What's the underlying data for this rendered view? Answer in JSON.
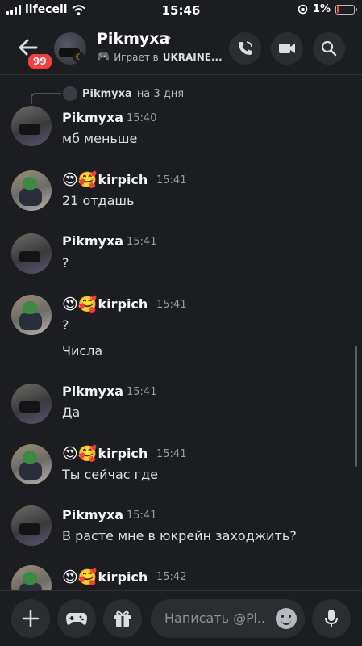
{
  "status_bar": {
    "carrier": "lifecell",
    "time": "15:46",
    "battery": "1%"
  },
  "header": {
    "name": "Pikmyxa",
    "chevron": "›",
    "unread_badge": "99",
    "activity_prefix": "Играет в",
    "activity_game": "UKRAINE..."
  },
  "reply": {
    "name": "Pikmyxa",
    "text": "на 3 дня"
  },
  "messages": [
    {
      "author": "Pikmyxa",
      "emoji": "",
      "time": "15:40",
      "lines": [
        "мб меньше"
      ]
    },
    {
      "author": "kirpich",
      "emoji": "😍🥰",
      "time": "15:41",
      "lines": [
        "21 отдашь"
      ]
    },
    {
      "author": "Pikmyxa",
      "emoji": "",
      "time": "15:41",
      "lines": [
        "?"
      ]
    },
    {
      "author": "kirpich",
      "emoji": "😍🥰",
      "time": "15:41",
      "lines": [
        "?",
        "Числа"
      ]
    },
    {
      "author": "Pikmyxa",
      "emoji": "",
      "time": "15:41",
      "lines": [
        "Да"
      ]
    },
    {
      "author": "kirpich",
      "emoji": "😍🥰",
      "time": "15:41",
      "lines": [
        "Ты сейчас где"
      ]
    },
    {
      "author": "Pikmyxa",
      "emoji": "",
      "time": "15:41",
      "lines": [
        "В расте мне в юкрейн заходжить?"
      ]
    },
    {
      "author": "kirpich",
      "emoji": "😍🥰",
      "time": "15:42",
      "lines": []
    }
  ],
  "composer": {
    "placeholder": "Написать @Pi.."
  },
  "icons": {
    "back": "arrow-left-icon",
    "call": "phone-call-icon",
    "video": "video-camera-icon",
    "search": "search-icon",
    "add": "plus-icon",
    "games": "gamepad-icon",
    "gift": "gift-icon",
    "emoji": "smile-icon",
    "mic": "microphone-icon"
  },
  "colors": {
    "background": "#1c1d21",
    "badge": "#f23f42",
    "surface": "#2b2d31"
  }
}
